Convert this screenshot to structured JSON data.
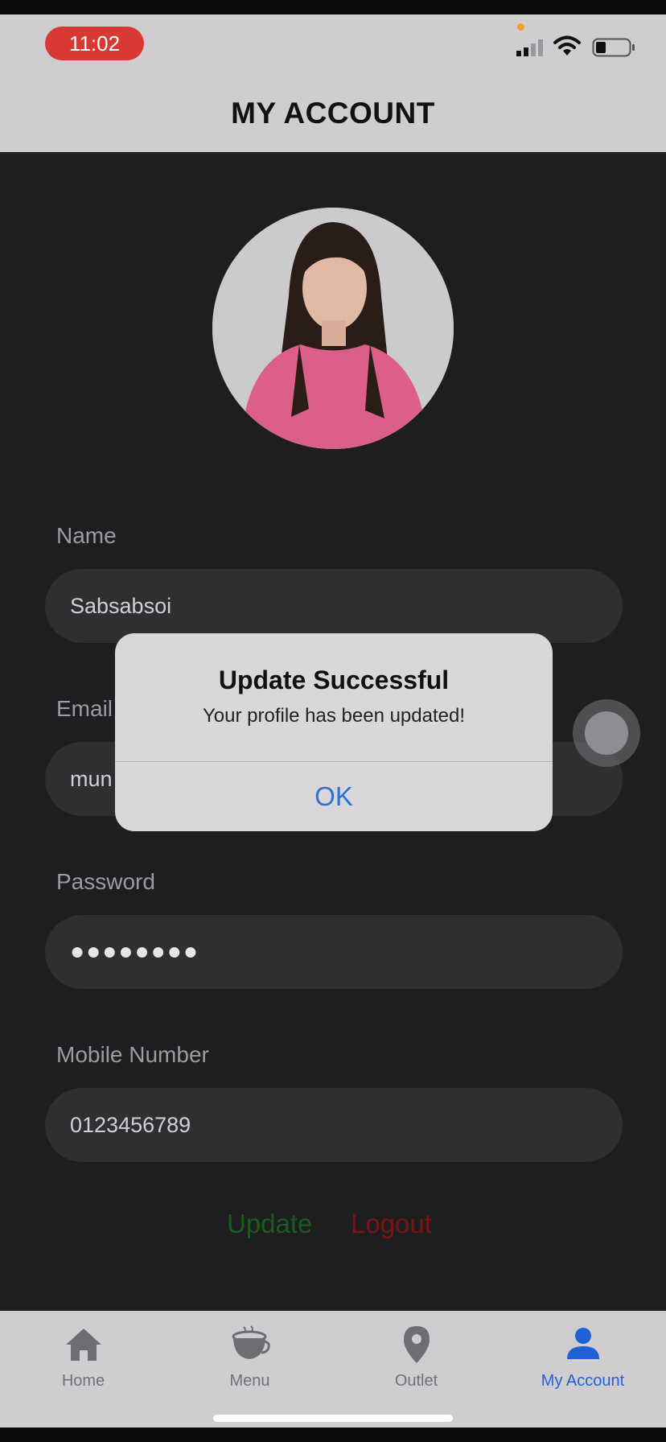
{
  "status_bar": {
    "time": "11:02"
  },
  "header": {
    "title": "MY ACCOUNT"
  },
  "profile": {
    "name_label": "Name",
    "name_value": "Sabsabsoi",
    "email_label": "Email",
    "email_value": "mun",
    "password_label": "Password",
    "password_value": "●●●●●●●●",
    "mobile_label": "Mobile Number",
    "mobile_value": "0123456789"
  },
  "actions": {
    "update_label": "Update",
    "logout_label": "Logout"
  },
  "alert": {
    "title": "Update Successful",
    "message": "Your profile has been updated!",
    "ok_label": "OK"
  },
  "tabbar": {
    "items": [
      {
        "label": "Home",
        "icon": "home-icon"
      },
      {
        "label": "Menu",
        "icon": "coffee-cup-icon"
      },
      {
        "label": "Outlet",
        "icon": "location-pin-icon"
      },
      {
        "label": "My Account",
        "icon": "person-icon"
      }
    ],
    "active": "My Account"
  },
  "colors": {
    "accent_blue": "#1f62d8",
    "update_green": "#1c5a1e",
    "logout_red": "#7a1612",
    "time_pill_red": "#d83a33"
  }
}
